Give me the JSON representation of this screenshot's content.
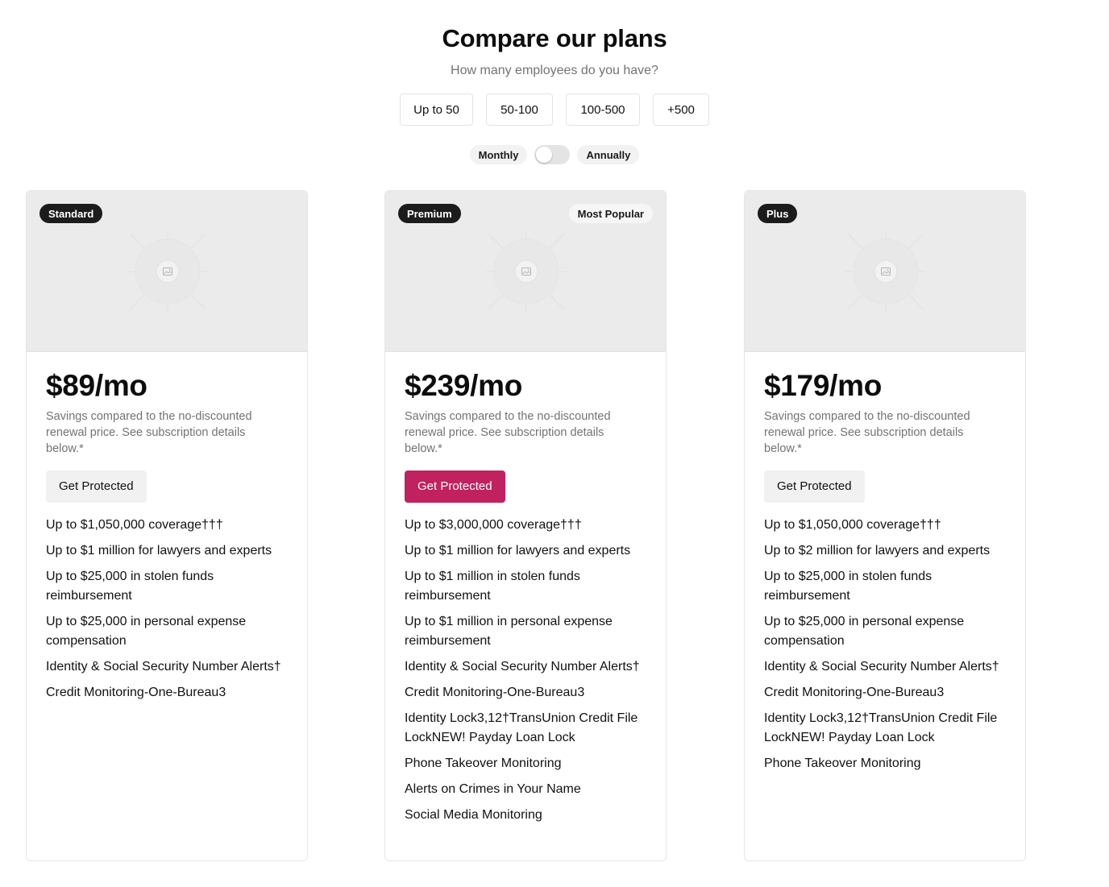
{
  "header": {
    "title": "Compare our plans",
    "subtitle": "How many employees do you have?"
  },
  "employee_options": [
    "Up to 50",
    "50-100",
    "100-500",
    "+500"
  ],
  "billing": {
    "monthly_label": "Monthly",
    "annually_label": "Annually",
    "annual_selected": false
  },
  "plans": [
    {
      "badge": "Standard",
      "price": "$89/mo",
      "savings": "Savings compared to the no-discounted renewal price. See subscription details below.*",
      "cta": "Get Protected",
      "features": [
        "Up to $1,050,000 coverage†††",
        "Up to $1 million for lawyers and experts",
        "Up to $25,000 in stolen funds reimbursement",
        "Up to $25,000 in personal expense compensation",
        "Identity & Social Security Number Alerts†",
        "Credit Monitoring-One-Bureau3"
      ]
    },
    {
      "badge": "Premium",
      "popular": "Most Popular",
      "price": "$239/mo",
      "savings": "Savings compared to the no-discounted renewal price. See subscription details below.*",
      "cta": "Get Protected",
      "features": [
        "Up to $3,000,000 coverage†††",
        "Up to $1 million for lawyers and experts",
        "Up to $1 million in stolen funds reimbursement",
        "Up to $1 million in personal expense reimbursement",
        "Identity & Social Security Number Alerts†",
        "Credit Monitoring-One-Bureau3",
        "Identity Lock3,12†TransUnion Credit File LockNEW! Payday Loan Lock",
        "Phone Takeover Monitoring",
        "Alerts on Crimes in Your Name",
        "Social Media Monitoring"
      ]
    },
    {
      "badge": "Plus",
      "price": "$179/mo",
      "savings": "Savings compared to the no-discounted renewal price. See subscription details below.*",
      "cta": "Get Protected",
      "features": [
        "Up to $1,050,000 coverage†††",
        "Up to $2 million for lawyers and experts",
        "Up to $25,000 in stolen funds reimbursement",
        "Up to $25,000 in personal expense compensation",
        "Identity & Social Security Number Alerts†",
        "Credit Monitoring-One-Bureau3",
        "Identity Lock3,12†TransUnion Credit File LockNEW! Payday Loan Lock",
        "Phone Takeover Monitoring"
      ]
    }
  ],
  "colors": {
    "accent": "#c1215f",
    "badge_dark": "#1c1c1c",
    "muted_text": "#737373",
    "image_placeholder": "#ebebeb"
  },
  "icons": {
    "image_placeholder": "image-placeholder-icon"
  }
}
